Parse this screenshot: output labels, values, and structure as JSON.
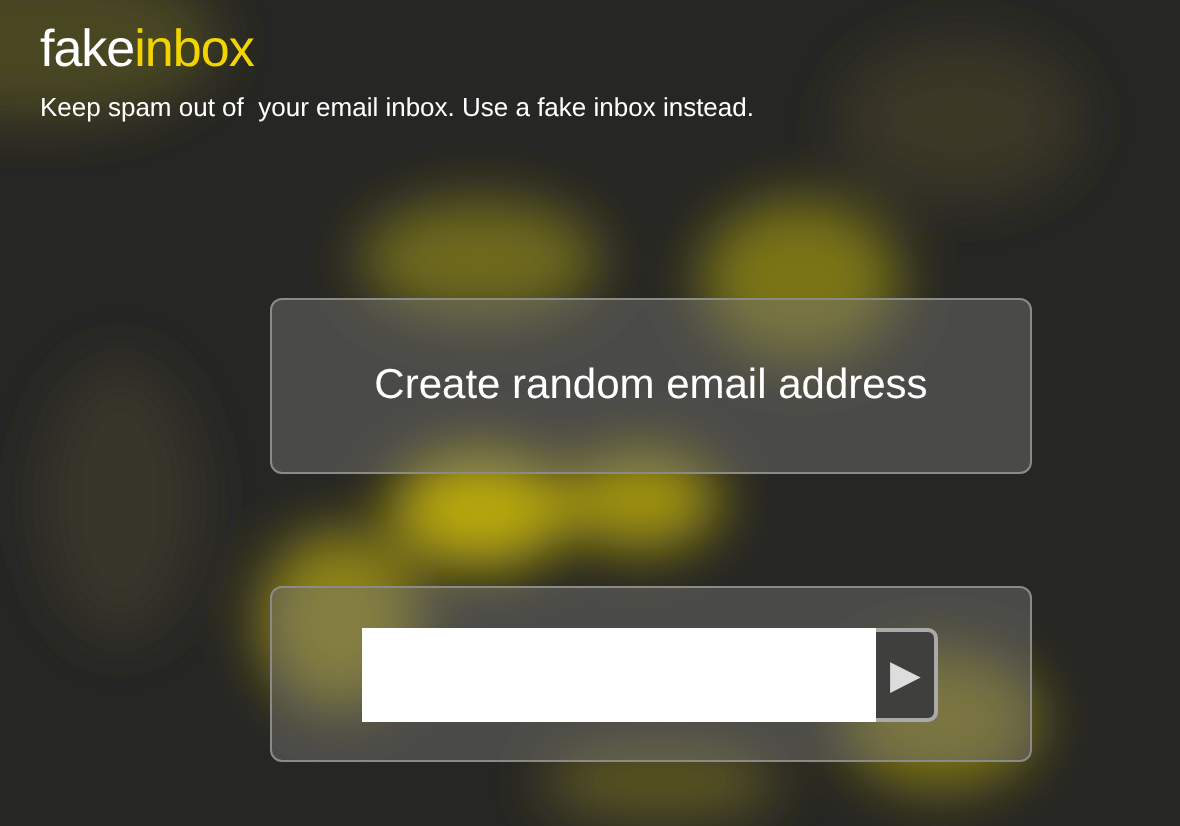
{
  "logo": [
    "fake",
    "inbox"
  ],
  "tagline": "Keep spam out of  your email inbox. Use a fake inbox instead.",
  "create_button": {
    "label": "Create random email address"
  },
  "address_form": {
    "submit_icon": "▶"
  }
}
